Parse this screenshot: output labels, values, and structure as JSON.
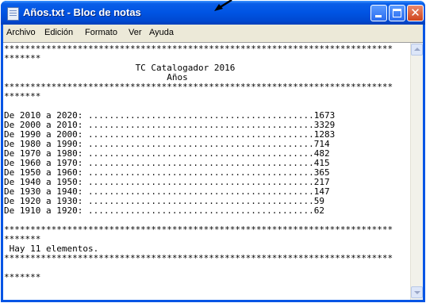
{
  "window": {
    "title": "Años.txt - Bloc de notas",
    "title_icon": "notepad-icon"
  },
  "menu": {
    "items": [
      {
        "label": "Archivo"
      },
      {
        "label": "Edición"
      },
      {
        "label": "Formato"
      },
      {
        "label": "Ver"
      },
      {
        "label": "Ayuda"
      }
    ]
  },
  "document": {
    "lines": [
      "**************************************************************************",
      "*******",
      "                         TC Catalogador 2016",
      "                               Años",
      "**************************************************************************",
      "*******",
      "",
      "De 2010 a 2020: ...........................................1673",
      "De 2000 a 2010: ...........................................3329",
      "De 1990 a 2000: ...........................................1283",
      "De 1980 a 1990: ...........................................714",
      "De 1970 a 1980: ...........................................482",
      "De 1960 a 1970: ...........................................415",
      "De 1950 a 1960: ...........................................365",
      "De 1940 a 1950: ...........................................217",
      "De 1930 a 1940: ...........................................147",
      "De 1920 a 1930: ...........................................59",
      "De 1910 a 1920: ...........................................62",
      "",
      "**************************************************************************",
      "*******",
      " Hay 11 elementos.",
      "**************************************************************************",
      "",
      "*******"
    ]
  },
  "colors": {
    "titlebar": "#0054e3",
    "close_button": "#d0441c",
    "frame": "#ece9d8"
  }
}
